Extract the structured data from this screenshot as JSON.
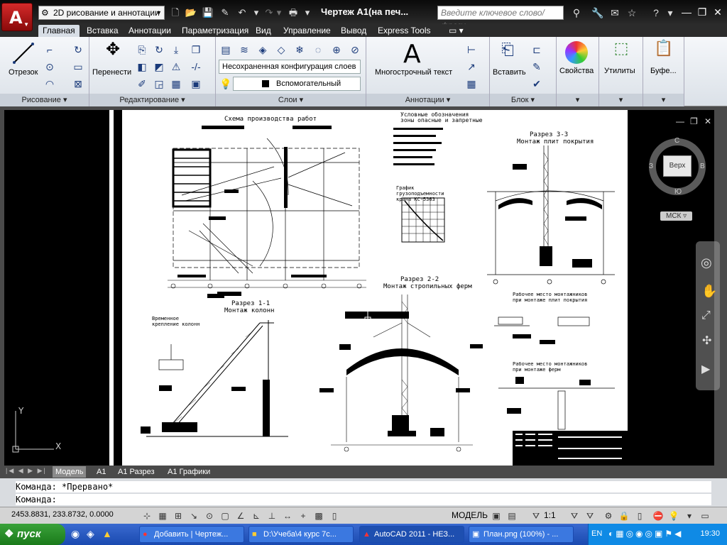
{
  "titlebar": {
    "workspace": "2D рисование и аннотации",
    "doc_title": "Чертеж А1(на печ...",
    "search_placeholder": "Введите ключевое слово/фразу"
  },
  "ribbon_tabs": [
    "Главная",
    "Вставка",
    "Аннотации",
    "Параметризация",
    "Вид",
    "Управление",
    "Вывод",
    "Express Tools"
  ],
  "ribbon": {
    "draw": {
      "line_label": "Отрезок",
      "panel_title": "Рисование"
    },
    "modify": {
      "move_label": "Перенести",
      "panel_title": "Редактирование"
    },
    "layers": {
      "layer_state": "Несохраненная конфигурация слоев",
      "current_layer": "Вспомогательный",
      "panel_title": "Слои"
    },
    "annotation": {
      "mtext_label": "Многострочный текст",
      "panel_title": "Аннотации"
    },
    "block": {
      "insert_label": "Вставить",
      "panel_title": "Блок"
    },
    "properties_label": "Свойства",
    "utilities_label": "Утилиты",
    "clipboard_label": "Буфе..."
  },
  "drawing": {
    "scheme_title": "Схема производства работ",
    "legend_title": "Условные обозначения",
    "legend_sub": "зоны опасные и запретные",
    "cut33_title": "Разрез 3-3",
    "cut33_sub": "Монтаж плит покрытия",
    "graph_title": "График грузоподъемности крана КС-5363",
    "cut22_title": "Разрез 2-2",
    "cut22_sub": "Монтаж стропильных ферм",
    "cut11_title": "Разрез 1-1",
    "cut11_sub": "Монтаж колонн",
    "detail_a": "Временное крепление колонн",
    "detail_b1": "Рабочее место монтажников при монтаже плит покрытия",
    "detail_b2": "Рабочее место монтажников при монтаже ферм"
  },
  "viewcube": {
    "face": "Верх",
    "north": "С",
    "south": "Ю",
    "west": "З",
    "east": "В",
    "ucs": "МСК"
  },
  "layout_tabs": [
    "Модель",
    "А1",
    "А1 Разрез",
    "А1 Графики"
  ],
  "command": {
    "history": "Команда: *Прервано*",
    "prompt": "Команда:"
  },
  "status": {
    "coords": "2453.8831, 233.8732, 0.0000",
    "mode": "МОДЕЛЬ",
    "scale": "1:1"
  },
  "taskbar": {
    "start": "пуск",
    "tasks": [
      "Добавить | Чертеж...",
      "D:\\Учеба\\4 курс 7с...",
      "AutoCAD 2011 - НЕЗ...",
      "План.png (100%) - ..."
    ],
    "lang": "EN",
    "clock": "19:30"
  },
  "colors": {
    "accent": "#d42a2a",
    "taskbar": "#245edb",
    "ribbon_bg": "#e6ebf1",
    "canvas": "#000000"
  }
}
